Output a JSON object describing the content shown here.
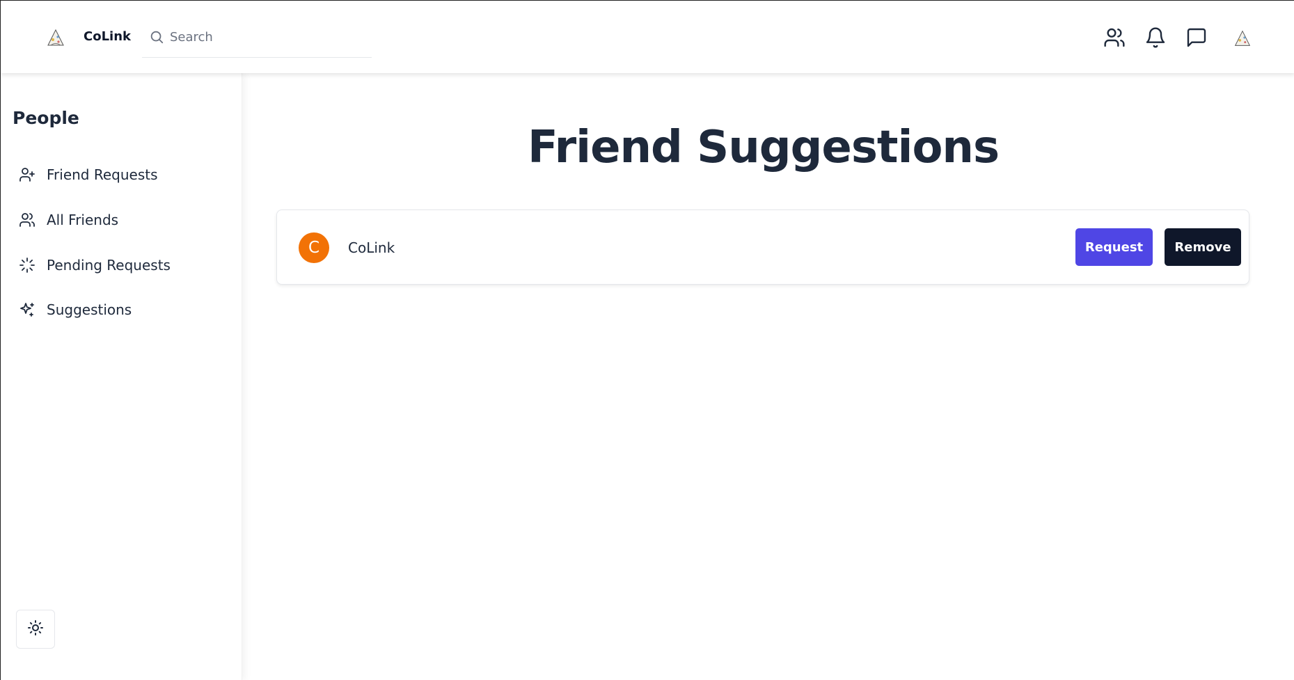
{
  "app": {
    "brand": "CoLink"
  },
  "search": {
    "placeholder": "Search"
  },
  "header_icons": [
    "people-icon",
    "bell-icon",
    "message-icon",
    "profile-avatar-icon"
  ],
  "sidebar": {
    "title": "People",
    "items": [
      {
        "label": "Friend Requests",
        "icon": "user-plus-icon"
      },
      {
        "label": "All Friends",
        "icon": "users-icon"
      },
      {
        "label": "Pending Requests",
        "icon": "loader-icon"
      },
      {
        "label": "Suggestions",
        "icon": "sparkles-icon"
      }
    ],
    "theme_toggle_icon": "sun-icon"
  },
  "main": {
    "title": "Friend Suggestions",
    "suggestions": [
      {
        "avatar_letter": "C",
        "name": "CoLink",
        "request_label": "Request",
        "remove_label": "Remove"
      }
    ]
  },
  "colors": {
    "primary": "#4f46e5",
    "dark": "#0f172a",
    "avatar": "#f27206",
    "text": "#1e293b"
  }
}
